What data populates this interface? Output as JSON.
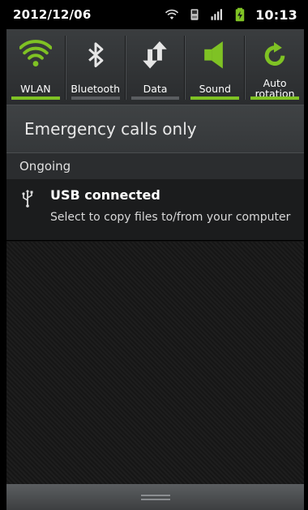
{
  "statusbar": {
    "date": "2012/12/06",
    "time": "10:13",
    "icons": [
      "wifi-icon",
      "sd-card-icon",
      "signal-icon",
      "battery-charging-icon"
    ]
  },
  "toggles": [
    {
      "id": "wlan",
      "label": "WLAN",
      "icon": "wifi-icon",
      "on": true
    },
    {
      "id": "bluetooth",
      "label": "Bluetooth",
      "icon": "bluetooth-icon",
      "on": false
    },
    {
      "id": "data",
      "label": "Data",
      "icon": "data-arrows-icon",
      "on": false
    },
    {
      "id": "sound",
      "label": "Sound",
      "icon": "speaker-icon",
      "on": true
    },
    {
      "id": "auto-rotation",
      "label": "Auto\nrotation",
      "icon": "rotate-icon",
      "on": true
    }
  ],
  "carrier": {
    "text": "Emergency calls only"
  },
  "ongoing": {
    "header": "Ongoing",
    "notifications": [
      {
        "icon": "usb-icon",
        "title": "USB connected",
        "subtitle": "Select to copy files to/from your computer"
      }
    ]
  },
  "colors": {
    "accent": "#7fc224",
    "toggle_off": "#5a5d60"
  }
}
